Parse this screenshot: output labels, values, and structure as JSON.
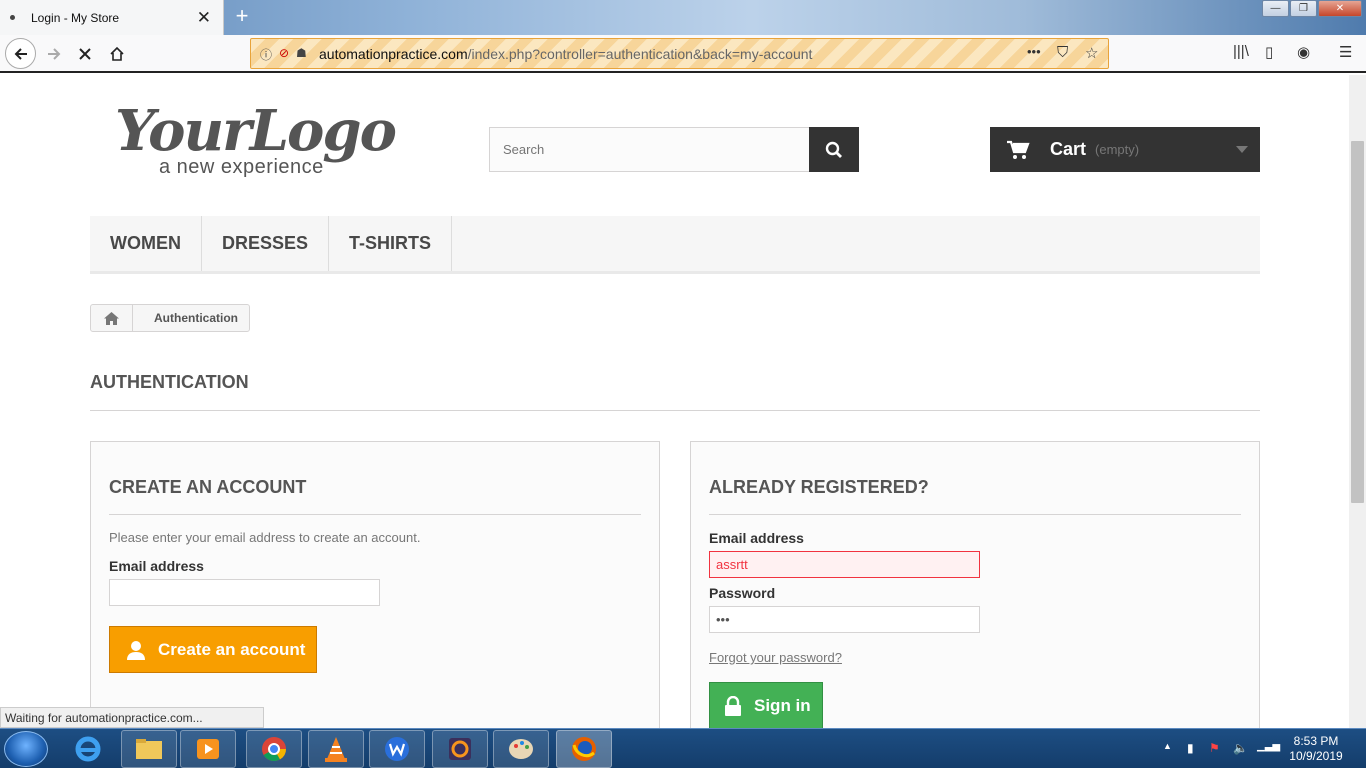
{
  "browser": {
    "tab_title": "Login - My Store",
    "new_tab": "+",
    "close_tab": "✕",
    "url_domain": "automationpractice.com",
    "url_path": "/index.php?controller=authentication&back=my-account",
    "more_actions": "•••",
    "status_text": "Waiting for automationpractice.com..."
  },
  "header": {
    "logo_main": "YourLogo",
    "logo_sub": "a new experience",
    "search_placeholder": "Search",
    "cart_label": "Cart",
    "cart_status": "(empty)"
  },
  "menu": {
    "items": [
      "WOMEN",
      "DRESSES",
      "T-SHIRTS"
    ]
  },
  "breadcrumb": {
    "current": "Authentication"
  },
  "page": {
    "title": "AUTHENTICATION"
  },
  "create_account": {
    "heading": "CREATE AN ACCOUNT",
    "intro": "Please enter your email address to create an account.",
    "email_label": "Email address",
    "email_value": "",
    "button_label": "Create an account"
  },
  "login": {
    "heading": "ALREADY REGISTERED?",
    "email_label": "Email address",
    "email_value": "assrtt",
    "password_label": "Password",
    "password_value": "•••",
    "forgot_link": "Forgot your password?",
    "button_label": "Sign in"
  },
  "taskbar": {
    "time": "8:53 PM",
    "date": "10/9/2019"
  },
  "colors": {
    "accent_orange": "#f89e00",
    "accent_green": "#43b155",
    "error_red": "#f13340",
    "dark": "#333333"
  }
}
